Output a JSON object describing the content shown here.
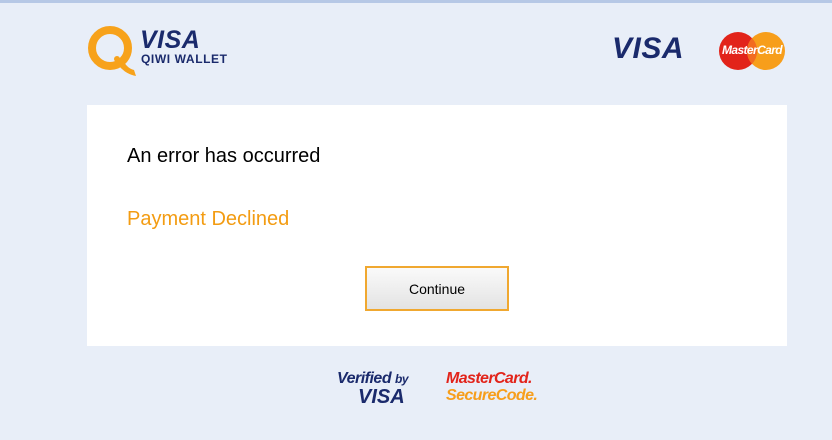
{
  "header": {
    "brand_visa": "VISA",
    "brand_wallet": "QIWI WALLET",
    "visa_logo": "VISA",
    "mastercard_logo": "MasterCard"
  },
  "card": {
    "error_title": "An error has occurred",
    "error_detail": "Payment Declined",
    "continue_label": "Continue"
  },
  "footer": {
    "verified_by": "Verified",
    "verified_by_small": "by",
    "verified_visa": "VISA",
    "mastercard": "MasterCard.",
    "securecode": "SecureCode."
  },
  "colors": {
    "background": "#e8eef8",
    "visa_blue": "#1a2a6c",
    "accent_orange": "#f39c12",
    "mastercard_red": "#e2231a",
    "mastercard_yellow": "#f79e1b"
  },
  "icons": [
    "qiwi-q-icon",
    "mastercard-circles-icon"
  ]
}
